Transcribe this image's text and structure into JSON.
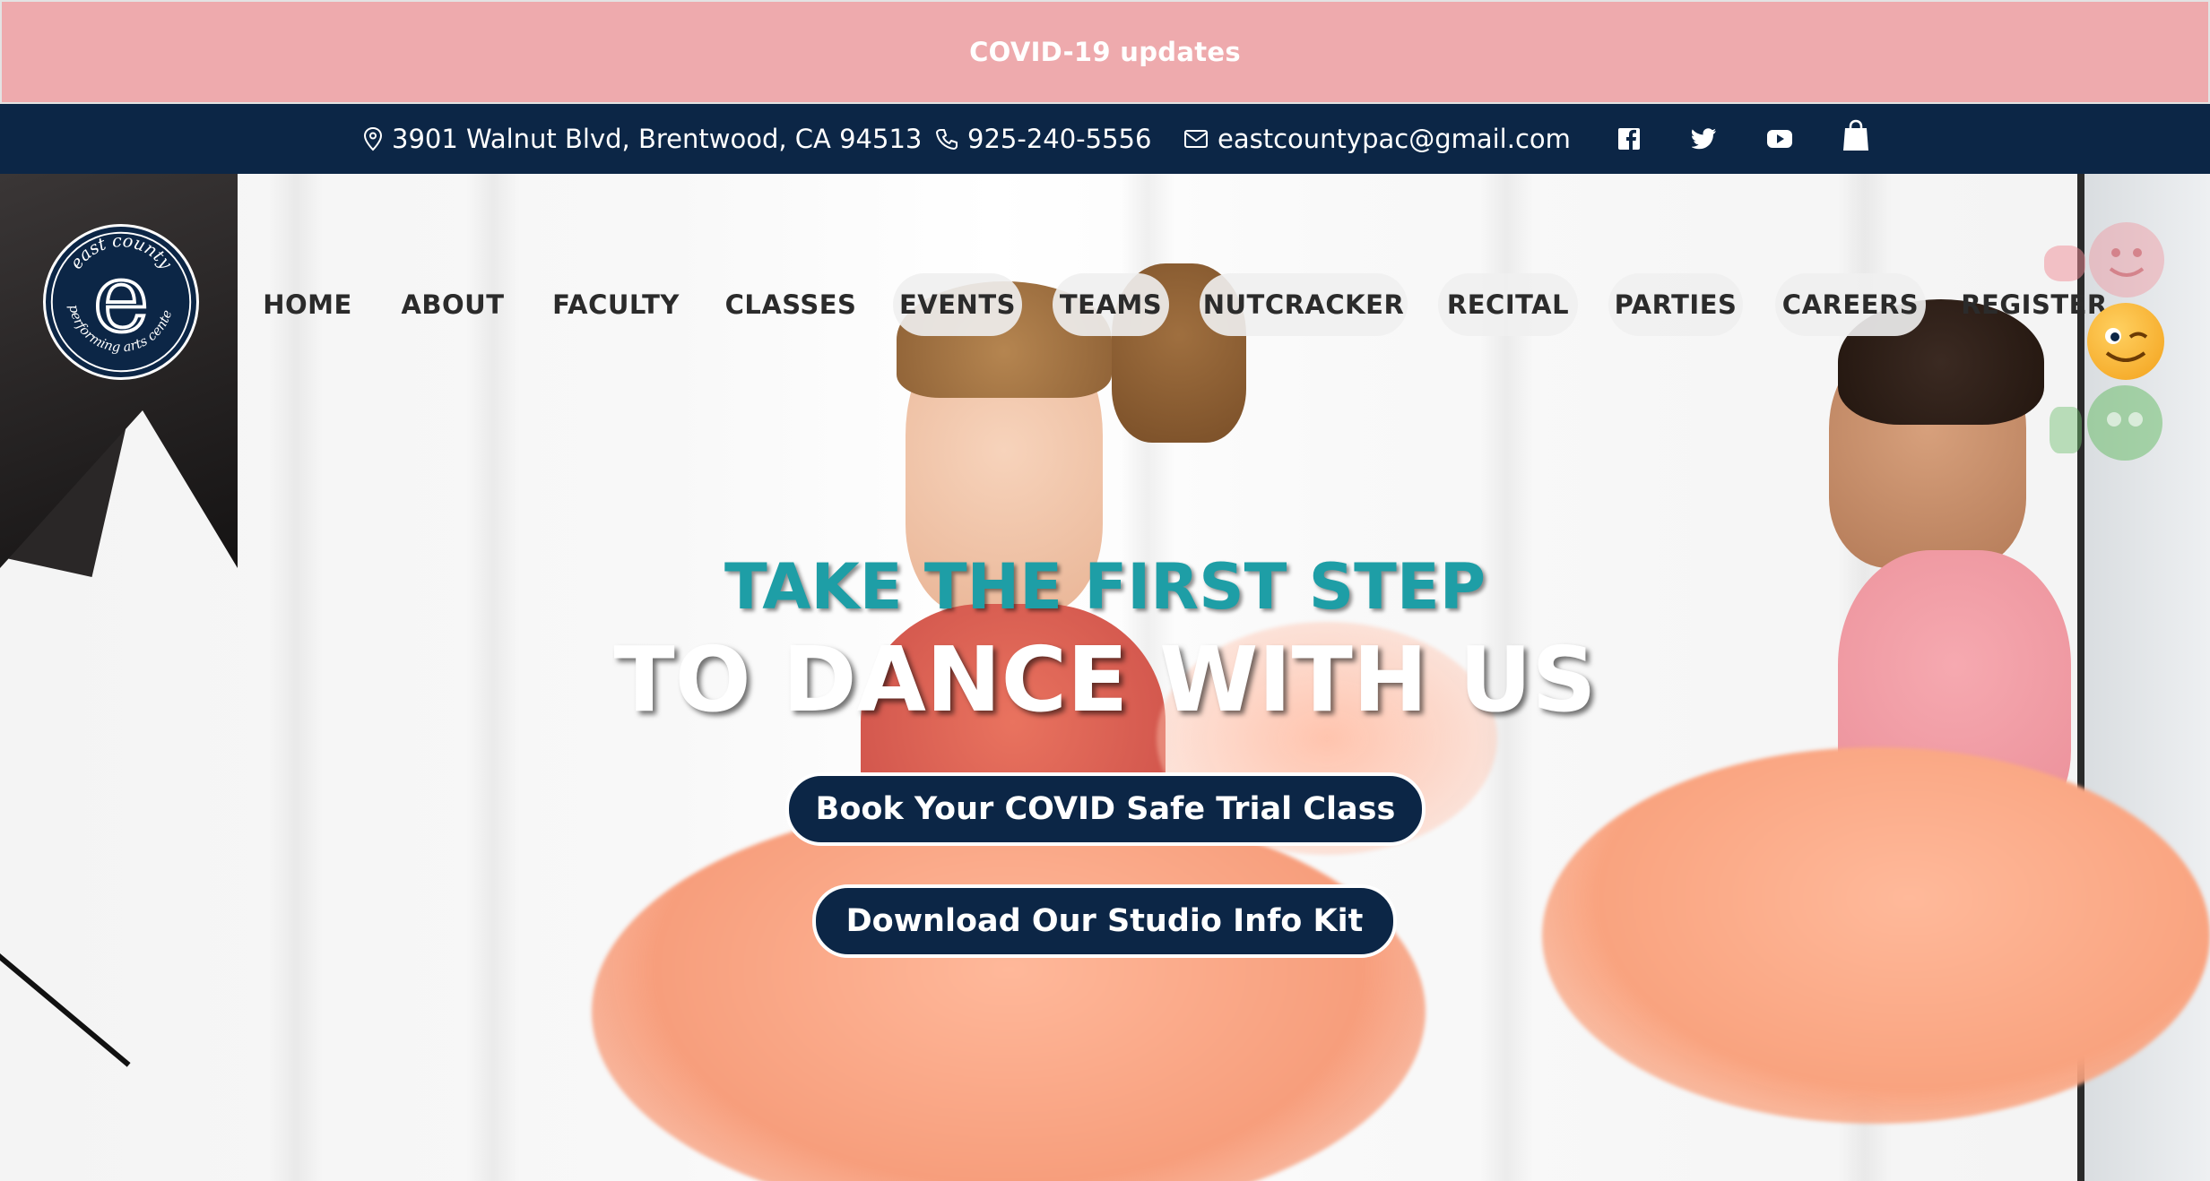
{
  "banner": {
    "label": "COVID-19 updates"
  },
  "contact": {
    "address": "3901 Walnut Blvd, Brentwood, CA 94513",
    "phone": "925-240-5556",
    "email": "eastcountypac@gmail.com"
  },
  "social": [
    "facebook-icon",
    "twitter-icon",
    "youtube-icon",
    "shopping-bag-icon"
  ],
  "logo": {
    "top_text": "east county",
    "bottom_text": "performing arts center",
    "letter": "e"
  },
  "nav": [
    {
      "label": "HOME"
    },
    {
      "label": "ABOUT"
    },
    {
      "label": "FACULTY"
    },
    {
      "label": "CLASSES"
    },
    {
      "label": "EVENTS"
    },
    {
      "label": "TEAMS"
    },
    {
      "label": "NUTCRACKER"
    },
    {
      "label": "RECITAL"
    },
    {
      "label": "PARTIES"
    },
    {
      "label": "CAREERS"
    },
    {
      "label": "REGISTER"
    }
  ],
  "hero": {
    "tagline": "TAKE THE FIRST STEP",
    "headline": "TO DANCE WITH US",
    "cta_primary": "Book Your COVID Safe Trial Class",
    "cta_secondary": "Download Our Studio Info Kit"
  },
  "colors": {
    "banner": "#eeaaad",
    "navy": "#0c2646",
    "teal": "#1e9ea6"
  }
}
